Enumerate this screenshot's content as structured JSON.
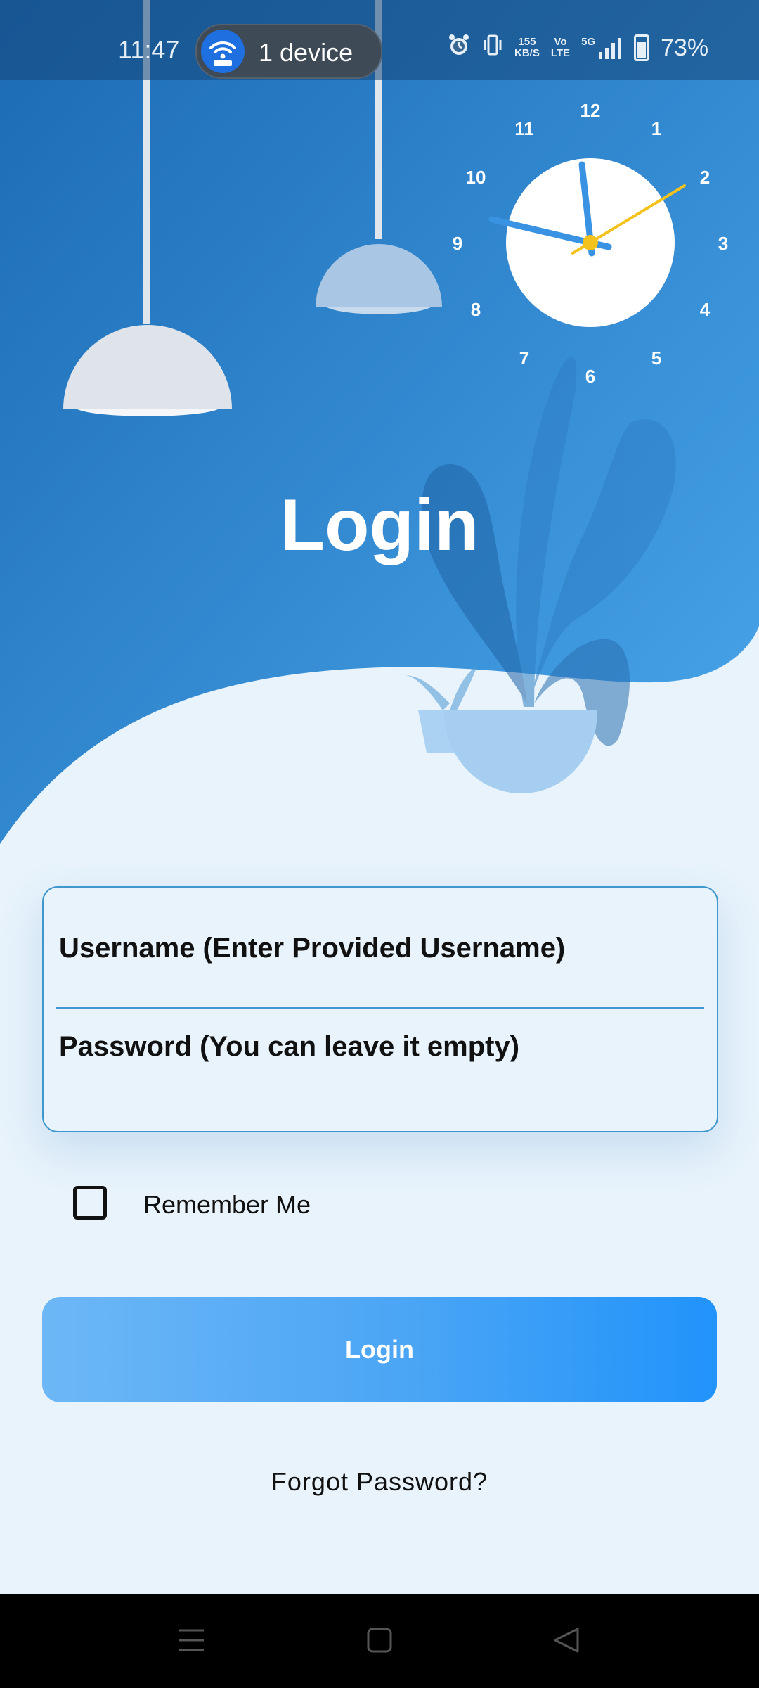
{
  "status_bar": {
    "time": "11:47",
    "hotspot_label": "1 device",
    "speed_value": "155",
    "speed_unit": "KB/S",
    "volte_top": "Vo",
    "volte_bottom": "LTE",
    "network": "5G",
    "battery": "73%"
  },
  "clock": {
    "numbers": [
      "12",
      "1",
      "2",
      "3",
      "4",
      "5",
      "6",
      "7",
      "8",
      "9",
      "10",
      "11"
    ]
  },
  "page": {
    "title": "Login"
  },
  "form": {
    "username_label": "Username (Enter Provided Username)",
    "password_label": "Password (You can leave it empty)",
    "remember_label": "Remember Me",
    "remember_checked": false,
    "login_button": "Login",
    "forgot_link": "Forgot Password?"
  },
  "colors": {
    "accent": "#2193fb",
    "hero_dark": "#1d6fb6",
    "hero_light": "#4fa8eb",
    "background": "#e8f3fb",
    "clock_second_hand": "#f3c21d"
  },
  "icons": {
    "hotspot": "wifi-hotspot-icon",
    "alarm": "alarm-icon",
    "vibrate": "vibrate-icon",
    "signal": "signal-icon",
    "battery": "battery-icon",
    "nav_recents": "menu-lines-icon",
    "nav_home": "square-home-icon",
    "nav_back": "triangle-back-icon"
  }
}
